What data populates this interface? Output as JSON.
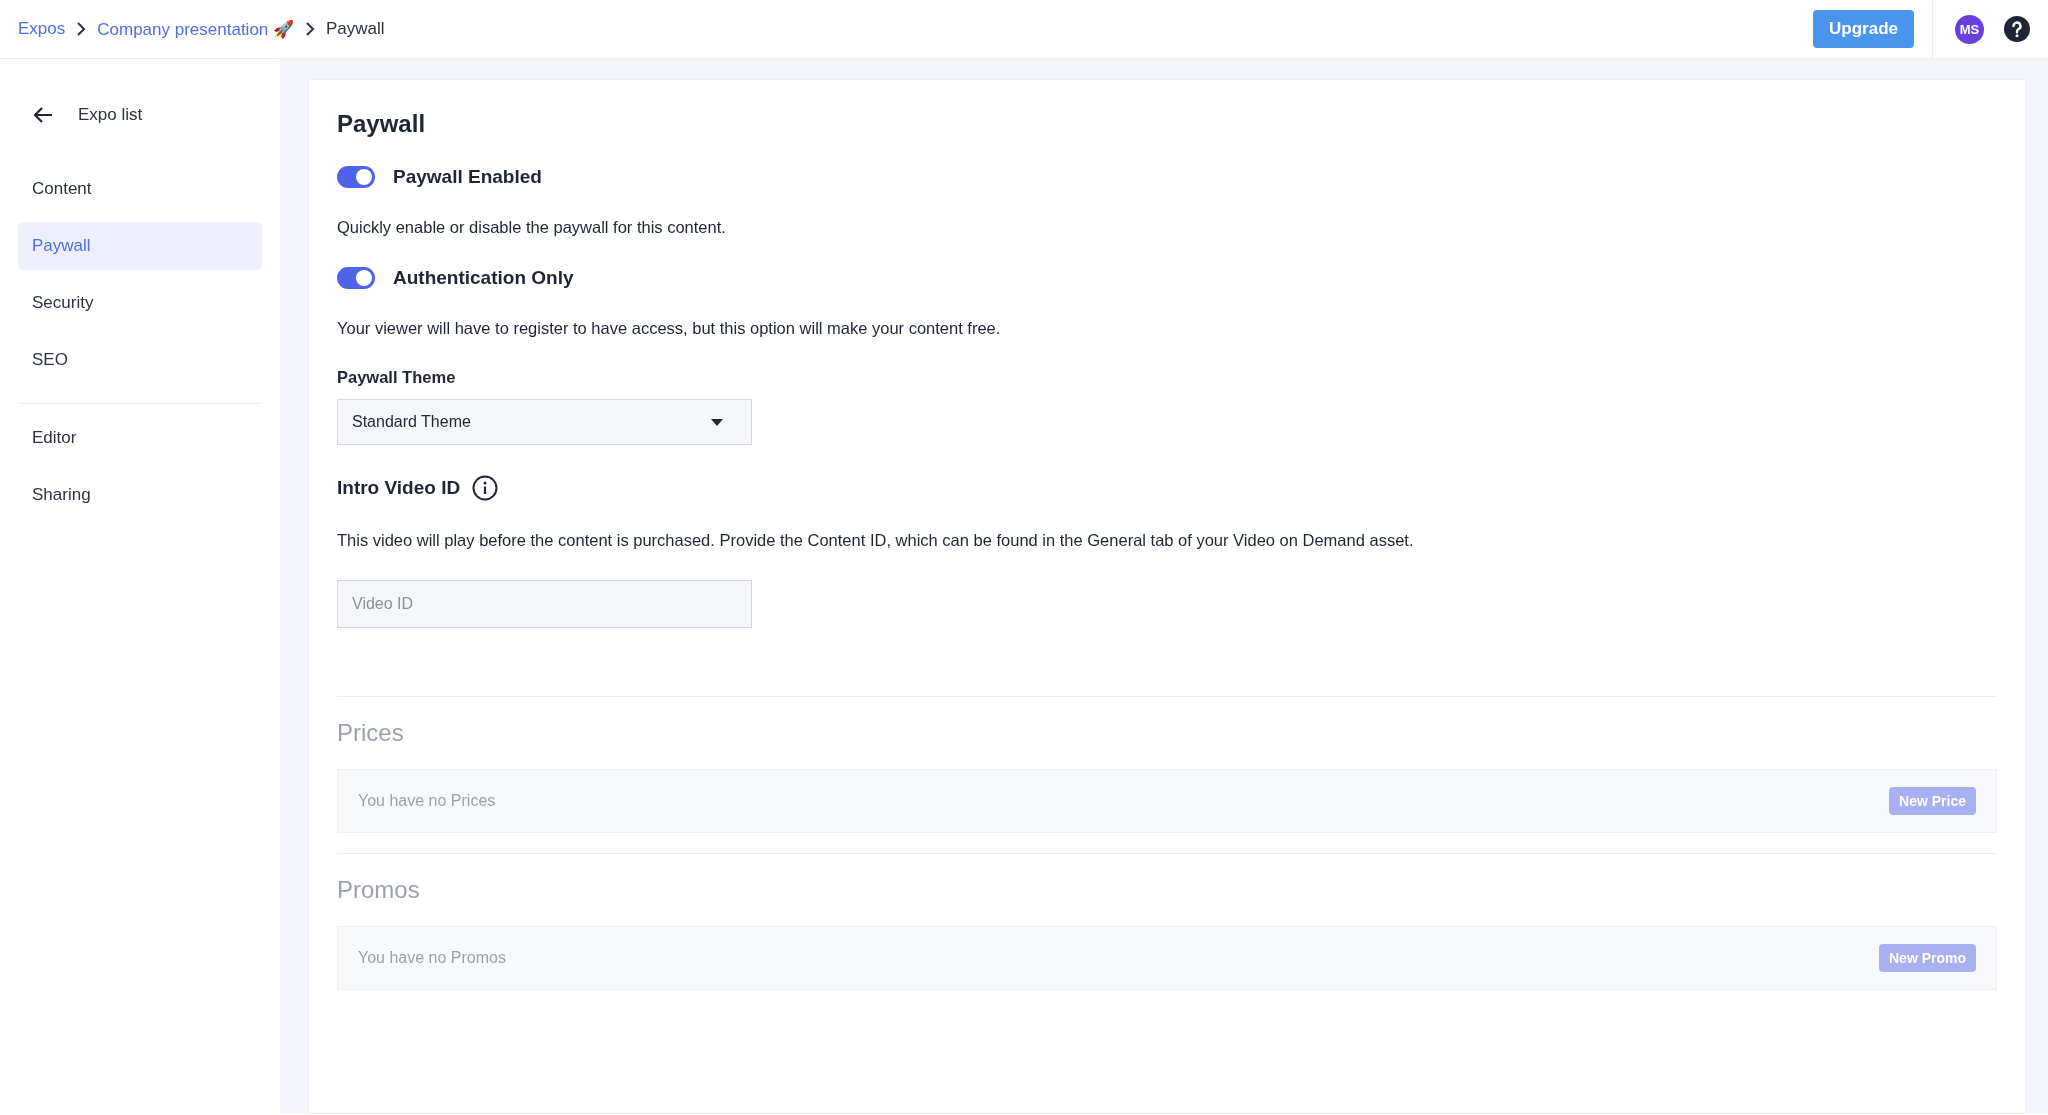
{
  "breadcrumbs": [
    {
      "label": "Expos",
      "link": true
    },
    {
      "label": "Company presentation 🚀",
      "link": true
    },
    {
      "label": "Paywall",
      "link": false
    }
  ],
  "header": {
    "upgrade_button": "Upgrade",
    "avatar": "MS"
  },
  "sidebar": {
    "back_label": "Expo list",
    "groups": [
      [
        {
          "label": "Content",
          "selected": false
        },
        {
          "label": "Paywall",
          "selected": true
        },
        {
          "label": "Security",
          "selected": false
        },
        {
          "label": "SEO",
          "selected": false
        }
      ],
      [
        {
          "label": "Editor",
          "selected": false
        },
        {
          "label": "Sharing",
          "selected": false
        }
      ]
    ]
  },
  "page": {
    "title": "Paywall",
    "toggles": [
      {
        "label": "Paywall Enabled",
        "on": true,
        "description": "Quickly enable or disable the paywall for this content."
      },
      {
        "label": "Authentication Only",
        "on": true,
        "description": "Your viewer will have to register to have access, but this option will make your content free."
      }
    ],
    "theme": {
      "label": "Paywall Theme",
      "value": "Standard Theme"
    },
    "intro_video": {
      "label": "Intro Video ID",
      "description": "This video will play before the content is purchased. Provide the Content ID, which can be found in the General tab of your Video on Demand asset.",
      "placeholder": "Video ID"
    },
    "sections": [
      {
        "title": "Prices",
        "empty_text": "You have no Prices",
        "button": "New Price",
        "disabled": true
      },
      {
        "title": "Promos",
        "empty_text": "You have no Promos",
        "button": "New Promo",
        "disabled": true
      }
    ]
  }
}
